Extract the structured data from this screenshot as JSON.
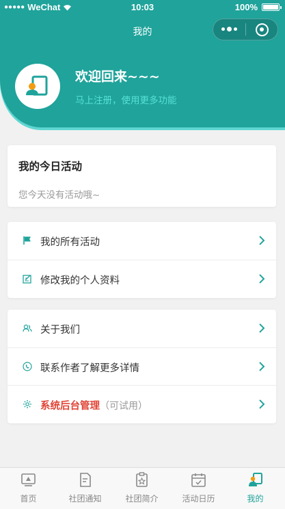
{
  "status_bar": {
    "carrier": "WeChat",
    "time": "10:03",
    "battery": "100%"
  },
  "nav": {
    "title": "我的"
  },
  "profile": {
    "welcome": "欢迎回来~~~",
    "register_hint": "马上注册，使用更多功能"
  },
  "today": {
    "title": "我的今日活动",
    "empty_text": "您今天没有活动哦~"
  },
  "menu_group_1": [
    {
      "label": "我的所有活动",
      "icon": "flag-icon"
    },
    {
      "label": "修改我的个人资料",
      "icon": "edit-icon"
    }
  ],
  "menu_group_2": [
    {
      "label": "关于我们",
      "icon": "users-icon"
    },
    {
      "label": "联系作者了解更多详情",
      "icon": "phone-icon"
    },
    {
      "label": "系统后台管理",
      "suffix": "（可试用）",
      "icon": "gear-icon"
    }
  ],
  "tabbar": [
    {
      "label": "首页",
      "icon": "home-icon"
    },
    {
      "label": "社团通知",
      "icon": "notice-icon"
    },
    {
      "label": "社团简介",
      "icon": "clipboard-icon"
    },
    {
      "label": "活动日历",
      "icon": "calendar-icon"
    },
    {
      "label": "我的",
      "icon": "profile-icon",
      "active": true
    }
  ],
  "colors": {
    "primary": "#1fa39b",
    "accent_light": "#58e0d6",
    "danger": "#e04436"
  }
}
